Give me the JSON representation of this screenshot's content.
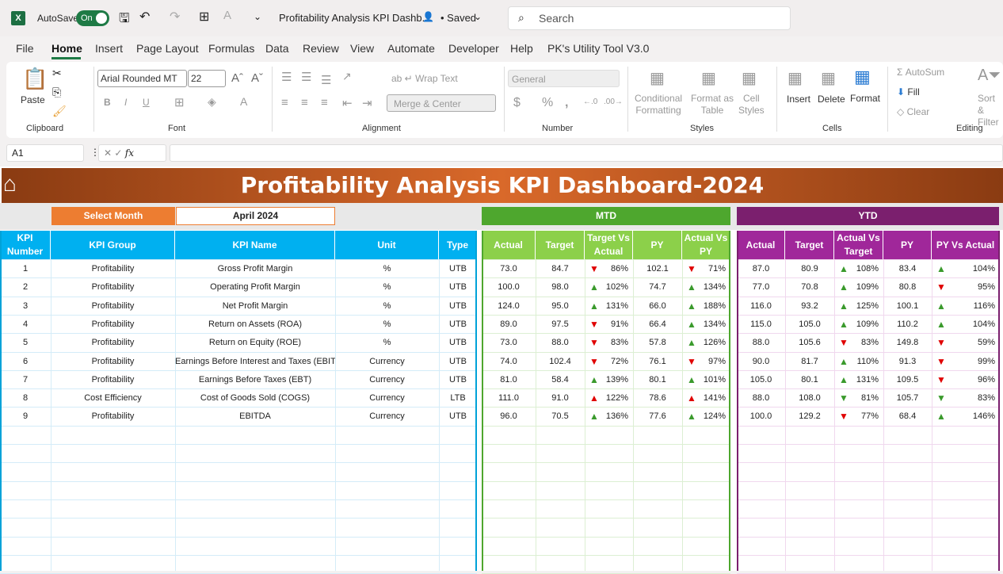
{
  "app": {
    "autosave_label": "AutoSave",
    "autosave_state": "On",
    "doc_title": "Profitability Analysis KPI Dashb...",
    "saved": "• Saved",
    "search_placeholder": "Search"
  },
  "menu": [
    "File",
    "Home",
    "Insert",
    "Page Layout",
    "Formulas",
    "Data",
    "Review",
    "View",
    "Automate",
    "Developer",
    "Help",
    "PK's Utility Tool V3.0"
  ],
  "ribbon": {
    "paste": "Paste",
    "font_name": "Arial Rounded MT",
    "font_size": "22",
    "wrap_text": "Wrap Text",
    "merge_center": "Merge & Center",
    "number_format": "General",
    "conditional": "Conditional",
    "formatting": "Formatting",
    "format_as": "Format as",
    "table": "Table",
    "cell": "Cell",
    "styles_l": "Styles",
    "insert": "Insert",
    "delete": "Delete",
    "format": "Format",
    "autosum": "AutoSum",
    "fill": "Fill",
    "clear": "Clear",
    "sort": "Sort &",
    "filter": "Filter",
    "groups": {
      "clipboard": "Clipboard",
      "font": "Font",
      "alignment": "Alignment",
      "number": "Number",
      "styles": "Styles",
      "cells": "Cells",
      "editing": "Editing"
    }
  },
  "formula_bar": {
    "name_box": "A1",
    "fx": "fx",
    "value": ""
  },
  "dashboard": {
    "title": "Profitability Analysis KPI Dashboard-2024",
    "select_month_label": "Select Month",
    "month": "April 2024",
    "mtd_label": "MTD",
    "ytd_label": "YTD",
    "colors": {
      "select": "#ed7d31",
      "left_header": "#00b0f0",
      "mtd": "#4ea72e",
      "mtd_header": "#8cd04a",
      "ytd": "#7b1f6e",
      "ytd_header": "#a0279a",
      "up": "#3a9a2c",
      "down": "#e00000"
    },
    "left_headers": [
      "KPI Number",
      "KPI Group",
      "KPI Name",
      "Unit",
      "Type"
    ],
    "mtd_headers": [
      "Actual",
      "Target",
      "Target Vs Actual",
      "PY",
      "Actual Vs PY"
    ],
    "ytd_headers": [
      "Actual",
      "Target",
      "Actual Vs Target",
      "PY",
      "PY Vs Actual"
    ],
    "rows": [
      {
        "n": "1",
        "group": "Profitability",
        "name": "Gross Profit Margin",
        "unit": "%",
        "type": "UTB",
        "mtd": [
          "73.0",
          "84.7",
          "86%",
          "102.1",
          "71%"
        ],
        "mtd_arrows": [
          "down-red",
          "down-red"
        ],
        "ytd": [
          "87.0",
          "80.9",
          "108%",
          "83.4",
          "104%"
        ],
        "ytd_arrows": [
          "up-green",
          "up-green"
        ]
      },
      {
        "n": "2",
        "group": "Profitability",
        "name": "Operating Profit Margin",
        "unit": "%",
        "type": "UTB",
        "mtd": [
          "100.0",
          "98.0",
          "102%",
          "74.7",
          "134%"
        ],
        "mtd_arrows": [
          "up-green",
          "up-green"
        ],
        "ytd": [
          "77.0",
          "70.8",
          "109%",
          "80.8",
          "95%"
        ],
        "ytd_arrows": [
          "up-green",
          "down-red"
        ]
      },
      {
        "n": "3",
        "group": "Profitability",
        "name": "Net Profit Margin",
        "unit": "%",
        "type": "UTB",
        "mtd": [
          "124.0",
          "95.0",
          "131%",
          "66.0",
          "188%"
        ],
        "mtd_arrows": [
          "up-green",
          "up-green"
        ],
        "ytd": [
          "116.0",
          "93.2",
          "125%",
          "100.1",
          "116%"
        ],
        "ytd_arrows": [
          "up-green",
          "up-green"
        ]
      },
      {
        "n": "4",
        "group": "Profitability",
        "name": "Return on Assets (ROA)",
        "unit": "%",
        "type": "UTB",
        "mtd": [
          "89.0",
          "97.5",
          "91%",
          "66.4",
          "134%"
        ],
        "mtd_arrows": [
          "down-red",
          "up-green"
        ],
        "ytd": [
          "115.0",
          "105.0",
          "109%",
          "110.2",
          "104%"
        ],
        "ytd_arrows": [
          "up-green",
          "up-green"
        ]
      },
      {
        "n": "5",
        "group": "Profitability",
        "name": "Return on Equity (ROE)",
        "unit": "%",
        "type": "UTB",
        "mtd": [
          "73.0",
          "88.0",
          "83%",
          "57.8",
          "126%"
        ],
        "mtd_arrows": [
          "down-red",
          "up-green"
        ],
        "ytd": [
          "88.0",
          "105.6",
          "83%",
          "149.8",
          "59%"
        ],
        "ytd_arrows": [
          "down-red",
          "down-red"
        ]
      },
      {
        "n": "6",
        "group": "Profitability",
        "name": "Earnings Before Interest and Taxes (EBIT)",
        "unit": "Currency",
        "type": "UTB",
        "mtd": [
          "74.0",
          "102.4",
          "72%",
          "76.1",
          "97%"
        ],
        "mtd_arrows": [
          "down-red",
          "down-red"
        ],
        "ytd": [
          "90.0",
          "81.7",
          "110%",
          "91.3",
          "99%"
        ],
        "ytd_arrows": [
          "up-green",
          "down-red"
        ]
      },
      {
        "n": "7",
        "group": "Profitability",
        "name": "Earnings Before Taxes (EBT)",
        "unit": "Currency",
        "type": "UTB",
        "mtd": [
          "81.0",
          "58.4",
          "139%",
          "80.1",
          "101%"
        ],
        "mtd_arrows": [
          "up-green",
          "up-green"
        ],
        "ytd": [
          "105.0",
          "80.1",
          "131%",
          "109.5",
          "96%"
        ],
        "ytd_arrows": [
          "up-green",
          "down-red"
        ]
      },
      {
        "n": "8",
        "group": "Cost Efficiency",
        "name": "Cost of Goods Sold (COGS)",
        "unit": "Currency",
        "type": "LTB",
        "mtd": [
          "111.0",
          "91.0",
          "122%",
          "78.6",
          "141%"
        ],
        "mtd_arrows": [
          "up-red",
          "up-red"
        ],
        "ytd": [
          "88.0",
          "108.0",
          "81%",
          "105.7",
          "83%"
        ],
        "ytd_arrows": [
          "down-green",
          "down-green"
        ]
      },
      {
        "n": "9",
        "group": "Profitability",
        "name": "EBITDA",
        "unit": "Currency",
        "type": "UTB",
        "mtd": [
          "96.0",
          "70.5",
          "136%",
          "77.6",
          "124%"
        ],
        "mtd_arrows": [
          "up-green",
          "up-green"
        ],
        "ytd": [
          "100.0",
          "129.2",
          "77%",
          "68.4",
          "146%"
        ],
        "ytd_arrows": [
          "down-red",
          "up-green"
        ]
      }
    ]
  }
}
